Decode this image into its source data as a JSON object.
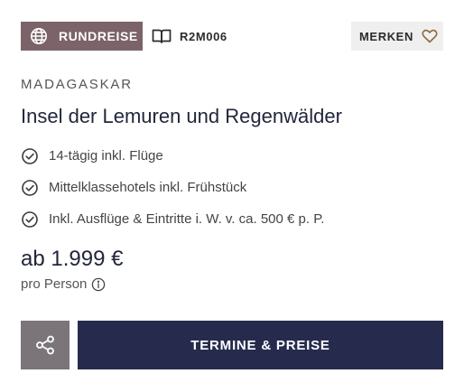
{
  "header": {
    "type_badge": {
      "label": "RUNDREISE",
      "icon": "globe-icon",
      "color": "#7b6369"
    },
    "trip_code": {
      "label": "R2M006",
      "icon": "book-icon"
    },
    "bookmark": {
      "label": "MERKEN",
      "icon": "heart-icon",
      "icon_color": "#8a6a3a"
    }
  },
  "trip": {
    "country": "MADAGASKAR",
    "title": "Insel der Lemuren und Regenwälder",
    "features": [
      {
        "icon": "check-circle-icon",
        "text": "14-tägig inkl. Flüge"
      },
      {
        "icon": "check-circle-icon",
        "text": "Mittelklassehotels inkl. Frühstück"
      },
      {
        "icon": "check-circle-icon",
        "text": "Inkl. Ausflüge & Eintritte i. W. v. ca. 500 € p. P."
      }
    ]
  },
  "pricing": {
    "price": "ab 1.999 €",
    "per_person": "pro Person",
    "info_icon": "info-icon"
  },
  "actions": {
    "share_icon": "share-icon",
    "cta_label": "TERMINE & PREISE",
    "cta_color": "#262b4d",
    "share_color": "#7b7579"
  }
}
